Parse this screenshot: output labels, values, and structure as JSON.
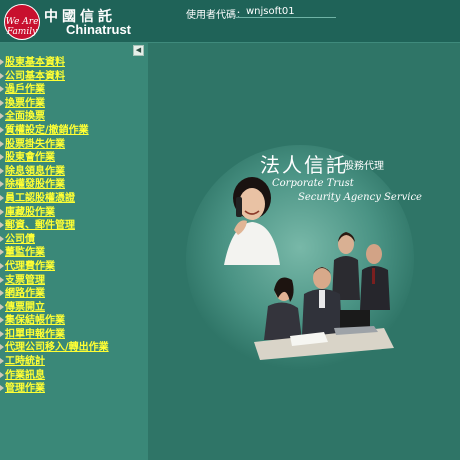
{
  "header": {
    "brand_cn": "中國信託",
    "brand_en": "Chinatrust",
    "logo_text": "We Are Family",
    "user_label": "使用者代碼：",
    "user_id": "wnjsoft01"
  },
  "sidebar": {
    "collapse_icon": "collapse-left-icon",
    "items": [
      "股東基本資料",
      "公司基本資料",
      "過戶作業",
      "換票作業",
      "全面換票",
      "質權設定/撤銷作業",
      "股票掛失作業",
      "股東會作業",
      "除息領息作業",
      "除權發股作業",
      "員工認股權憑證",
      "庫藏股作業",
      "郵資、郵件管理",
      "公司債",
      "董監作業",
      "代理費作業",
      "支票管理",
      "網路作業",
      "傳票開立",
      "集保結帳作業",
      "扣單申報作業",
      "代理公司移入/轉出作業",
      "工時統計",
      "作業訊息",
      "管理作業"
    ]
  },
  "main": {
    "title_cn": "法人信託",
    "title_sub": "股務代理",
    "subtitle_en_1": "Corporate Trust",
    "subtitle_en_2": "Security Agency Service"
  },
  "colors": {
    "header_bg": "#1f6358",
    "sidebar_bg": "#3a8878",
    "main_bg": "#2f7567",
    "menu_text": "#ffff33",
    "brand_red": "#c8102e"
  }
}
